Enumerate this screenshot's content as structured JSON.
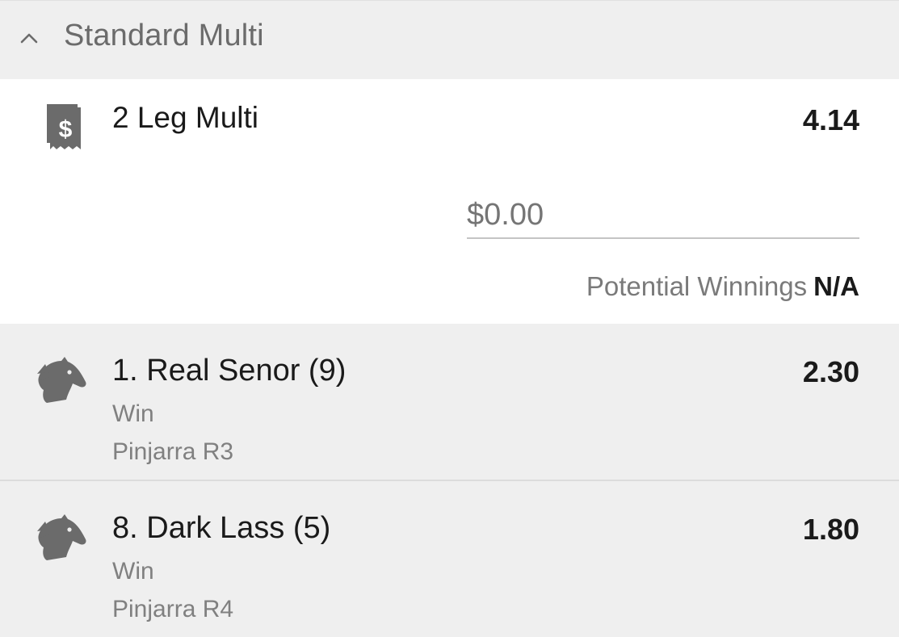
{
  "section": {
    "title": "Standard Multi"
  },
  "multi": {
    "title": "2 Leg Multi",
    "odds": "4.14",
    "stake_placeholder": "$0.00",
    "winnings_label": "Potential Winnings",
    "winnings_value": "N/A"
  },
  "legs": [
    {
      "name": "1. Real Senor (9)",
      "odds": "2.30",
      "bet_type": "Win",
      "track": "Pinjarra R3"
    },
    {
      "name": "8. Dark Lass (5)",
      "odds": "1.80",
      "bet_type": "Win",
      "track": "Pinjarra R4"
    }
  ],
  "colors": {
    "background": "#efefef",
    "card": "#ffffff",
    "icon": "#6b6b6b",
    "text_primary": "#1a1a1a",
    "text_secondary": "#808080"
  },
  "icons": {
    "collapse": "chevron-up-icon",
    "multi": "receipt-dollar-icon",
    "leg": "horse-head-icon"
  }
}
